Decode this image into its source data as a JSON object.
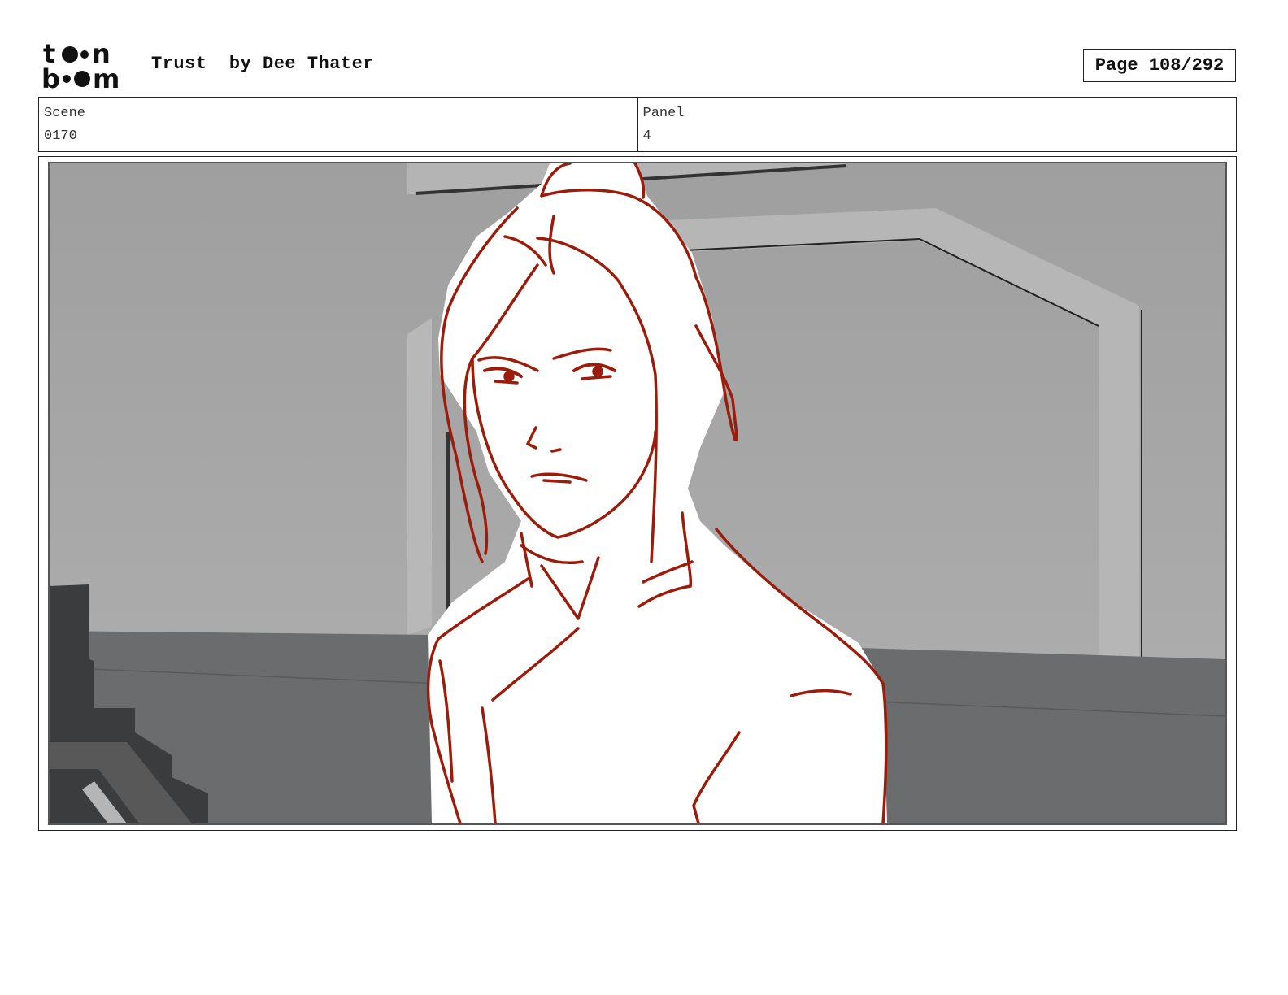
{
  "header": {
    "logo_alt": "toon boom",
    "title": "Trust  by Dee Thater",
    "page_label": "Page 108/292"
  },
  "info": {
    "scene_label": "Scene",
    "scene_value": "0170",
    "panel_label": "Panel",
    "panel_value": "4"
  },
  "colors": {
    "sketch_line": "#9b1c0a",
    "wall": "#a6a6a6",
    "floor": "#6b6c6d"
  }
}
